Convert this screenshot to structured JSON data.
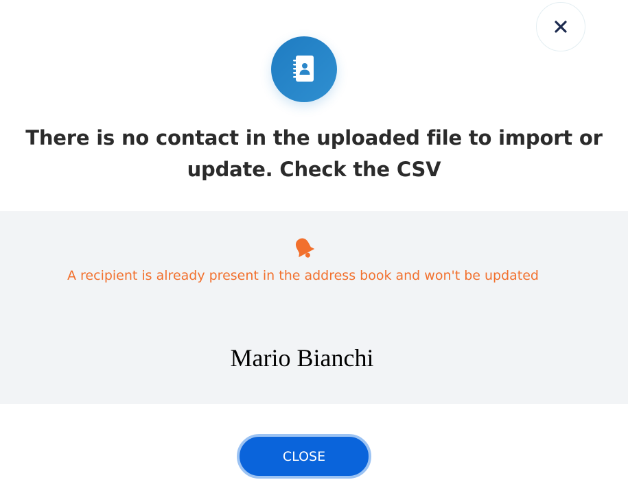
{
  "dialog": {
    "close_icon": "close-icon",
    "hero_icon": "address-book-icon",
    "title": "There is no contact in the uploaded file to import or update. Check the CSV",
    "warning": {
      "icon": "bell-icon",
      "text": "A recipient is already present in the address book and won't be updated",
      "contacts": [
        "Mario Bianchi"
      ]
    },
    "close_button_label": "CLOSE"
  },
  "colors": {
    "accent_blue": "#0a64db",
    "icon_blue": "#2a86c9",
    "warning_orange": "#f2702d",
    "panel_background": "#f2f4f6",
    "title_text": "#2b2b2b"
  }
}
